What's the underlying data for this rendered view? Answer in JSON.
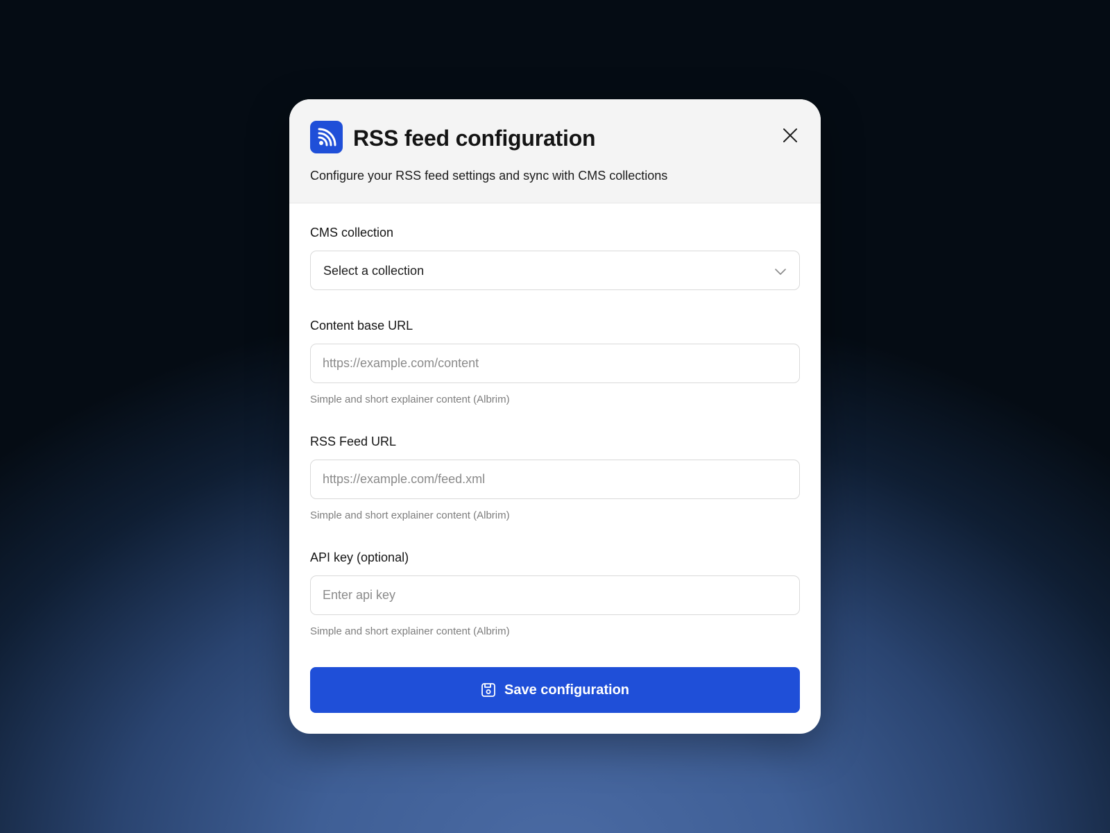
{
  "modal": {
    "title": "RSS feed configuration",
    "subtitle": "Configure your RSS feed settings and sync with CMS collections",
    "app_icon": "rss-icon",
    "close_icon": "close-icon"
  },
  "fields": {
    "collection": {
      "label": "CMS collection",
      "value": "Select a collection",
      "icon": "chevron-down-icon"
    },
    "content_url": {
      "label": "Content base URL",
      "placeholder": "https://example.com/content",
      "helper": "Simple and short explainer content (Albrim)"
    },
    "feed_url": {
      "label": "RSS Feed URL",
      "placeholder": "https://example.com/feed.xml",
      "helper": "Simple and short explainer content (Albrim)"
    },
    "api_key": {
      "label": "API key (optional)",
      "placeholder": "Enter api key",
      "helper": "Simple and short explainer content (Albrim)"
    }
  },
  "actions": {
    "save_label": "Save configuration",
    "save_icon": "save-icon"
  },
  "colors": {
    "accent": "#1f4fd8",
    "header_bg": "#f4f4f4",
    "helper_text": "#7d7d7d"
  }
}
